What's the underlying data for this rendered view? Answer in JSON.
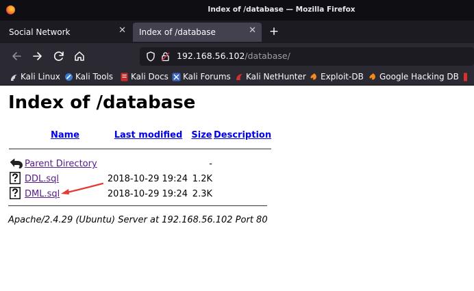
{
  "window": {
    "title": "Index of /database — Mozilla Firefox"
  },
  "tabs": [
    {
      "label": "Social Network",
      "active": false
    },
    {
      "label": "Index of /database",
      "active": true
    }
  ],
  "nav": {
    "url_host": "192.168.56.102",
    "url_path": "/database/"
  },
  "bookmarks": [
    {
      "label": "Kali Linux",
      "icon": "kali-dragon-icon"
    },
    {
      "label": "Kali Tools",
      "icon": "kali-tools-icon"
    },
    {
      "label": "Kali Docs",
      "icon": "kali-docs-icon"
    },
    {
      "label": "Kali Forums",
      "icon": "kali-forums-icon"
    },
    {
      "label": "Kali NetHunter",
      "icon": "nethunter-icon"
    },
    {
      "label": "Exploit-DB",
      "icon": "exploit-db-icon"
    },
    {
      "label": "Google Hacking DB",
      "icon": "ghdb-icon"
    }
  ],
  "page": {
    "title": "Index of /database",
    "columns": {
      "name": "Name",
      "last_modified": "Last modified",
      "size": "Size",
      "description": "Description"
    },
    "entries": [
      {
        "name": "Parent Directory",
        "last_modified": "",
        "size": "-",
        "description": "",
        "icon": "back-folder-icon"
      },
      {
        "name": "DDL.sql",
        "last_modified": "2018-10-29 19:24",
        "size": "1.2K",
        "description": "",
        "icon": "unknown-file-icon"
      },
      {
        "name": "DML.sql",
        "last_modified": "2018-10-29 19:24",
        "size": "2.3K",
        "description": "",
        "icon": "unknown-file-icon"
      }
    ],
    "address": "Apache/2.4.29 (Ubuntu) Server at 192.168.56.102 Port 80"
  },
  "annotation": {
    "color": "#e53935"
  }
}
